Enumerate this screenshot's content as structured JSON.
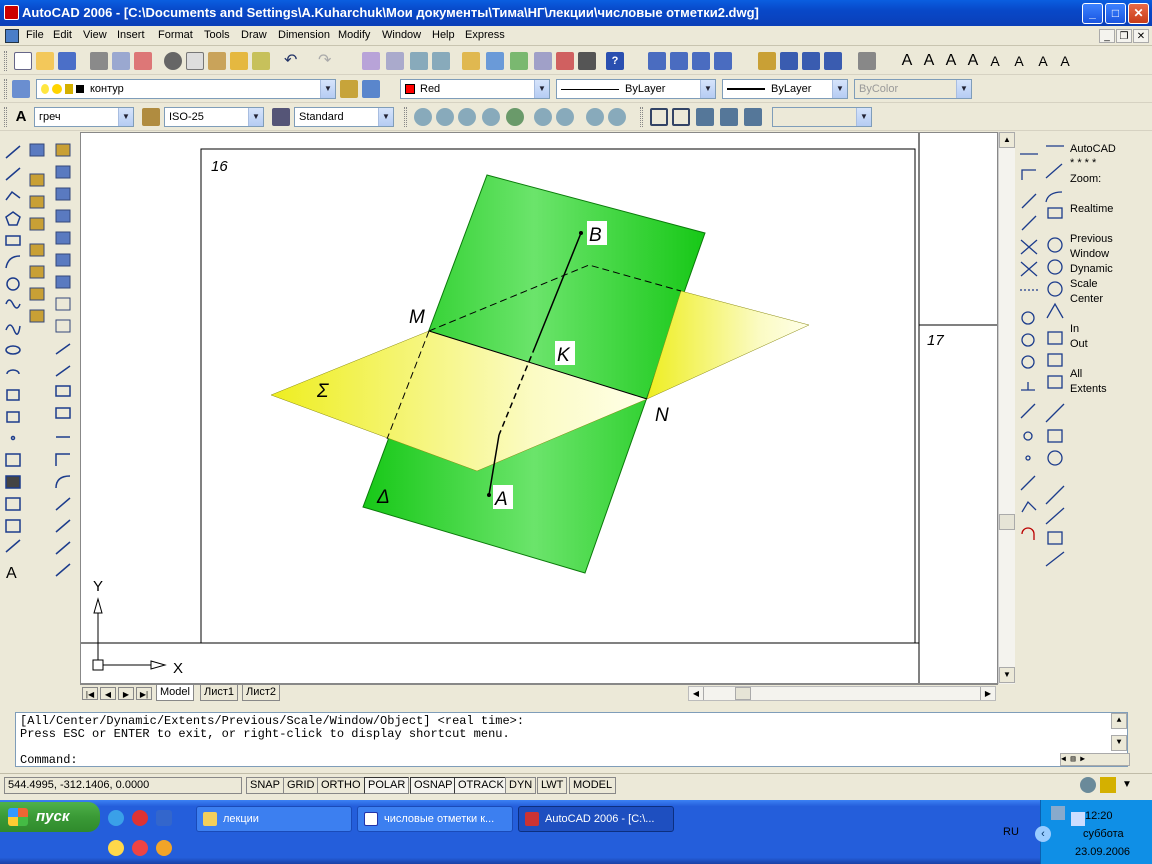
{
  "window": {
    "title": "AutoCAD 2006 - [C:\\Documents and Settings\\A.Kuharchuk\\Мои документы\\Тима\\НГ\\лекции\\числовые отметки2.dwg]"
  },
  "menu": [
    "File",
    "Edit",
    "View",
    "Insert",
    "Format",
    "Tools",
    "Draw",
    "Dimension",
    "Modify",
    "Window",
    "Help",
    "Express"
  ],
  "layers": {
    "layer_name": "контур",
    "color": "Red",
    "linetype": "ByLayer",
    "lineweight": "ByLayer",
    "plotstyle": "ByColor"
  },
  "styles": {
    "text_style": "греч",
    "dim_style": "ISO-25",
    "table_style": "Standard"
  },
  "drawing": {
    "sheet_num_left": "16",
    "sheet_num_right": "17",
    "labels": {
      "B": "B",
      "M": "M",
      "K": "K",
      "N": "N",
      "A": "A",
      "sigma": "Σ",
      "delta": "Δ"
    },
    "colors": {
      "green_plane": "#22d122",
      "yellow_plane": "#f2f02a",
      "ucs": "#000000"
    },
    "ucs": {
      "x": "X",
      "y": "Y"
    }
  },
  "tabs": [
    "Model",
    "Лист1",
    "Лист2"
  ],
  "zoom_panel": [
    "AutoCAD",
    "* * * *",
    "Zoom:",
    "Realtime",
    "Previous",
    "Window",
    "Dynamic",
    "Scale",
    "Center",
    "In",
    "Out",
    "All",
    "Extents"
  ],
  "command": {
    "line1": "[All/Center/Dynamic/Extents/Previous/Scale/Window/Object] <real time>:",
    "line2": "Press ESC or ENTER to exit, or right-click to display shortcut menu.",
    "prompt": "Command:"
  },
  "status": {
    "coords": "544.4995, -312.1406, 0.0000",
    "buttons": [
      "SNAP",
      "GRID",
      "ORTHO",
      "POLAR",
      "OSNAP",
      "OTRACK",
      "DYN",
      "LWT",
      "MODEL"
    ]
  },
  "taskbar": {
    "start": "пуск",
    "tasks": [
      "лекции",
      "числовые отметки к...",
      "AutoCAD 2006 - [C:\\..."
    ],
    "lang": "RU",
    "time": "12:20",
    "day": "суббота",
    "date": "23.09.2006"
  }
}
